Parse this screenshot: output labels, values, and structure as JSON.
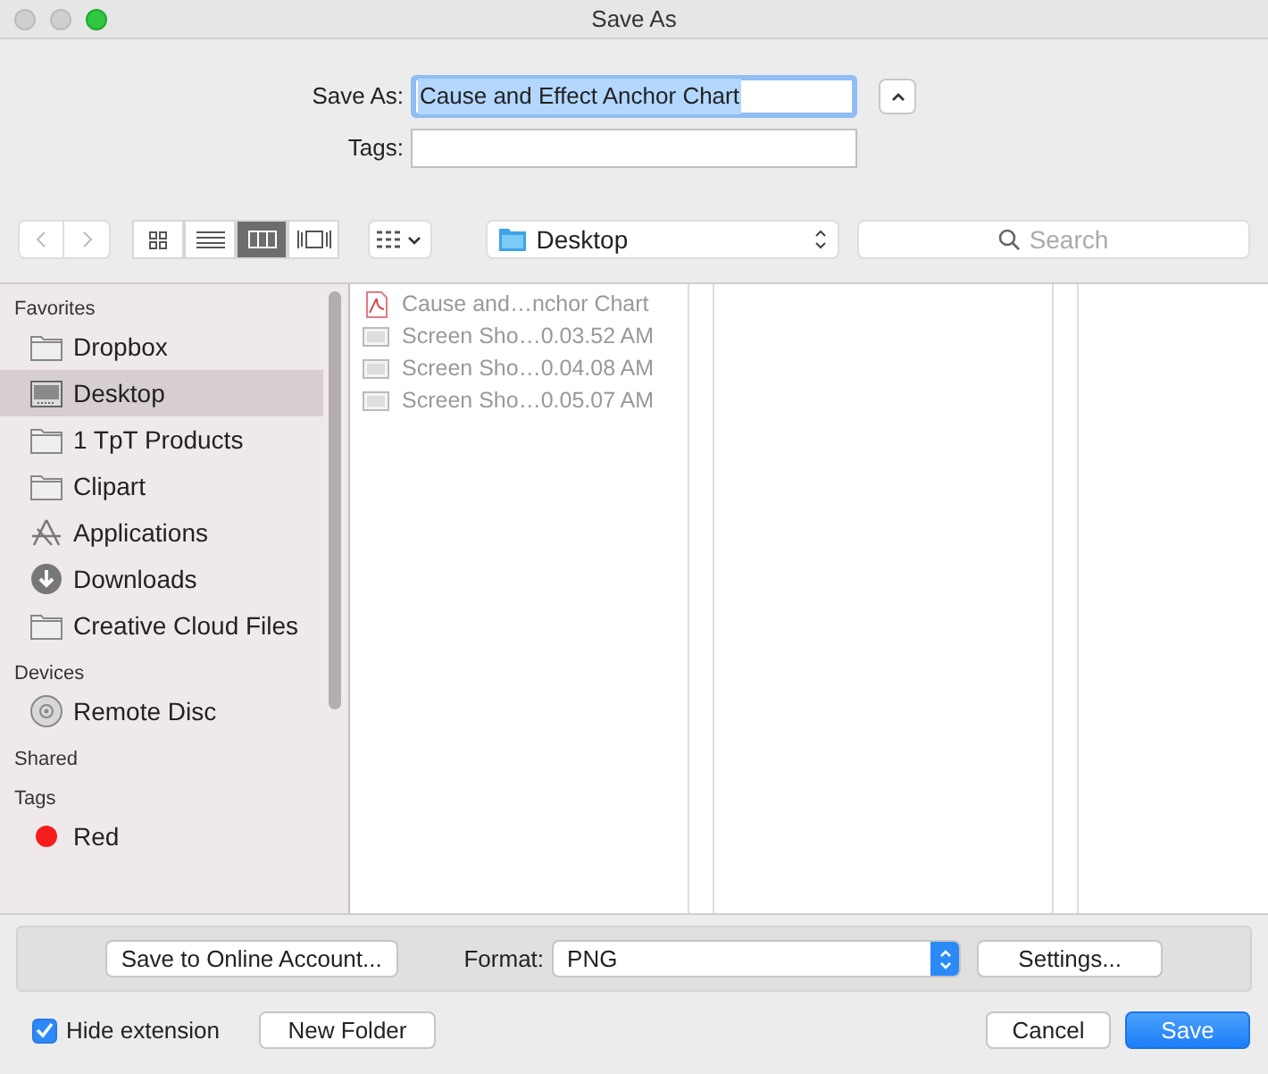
{
  "window": {
    "title": "Save As"
  },
  "save_as": {
    "label": "Save As:",
    "value": "Cause and Effect Anchor Chart",
    "selected_text": true
  },
  "tags": {
    "label": "Tags:"
  },
  "toolbar": {
    "views": [
      {
        "kind": "icons",
        "selected": false
      },
      {
        "kind": "list",
        "selected": false
      },
      {
        "kind": "columns",
        "selected": true
      },
      {
        "kind": "coverflow",
        "selected": false
      }
    ],
    "location": "Desktop",
    "search": {
      "placeholder": "Search"
    }
  },
  "sidebar": {
    "sections": [
      {
        "title": "Favorites",
        "items": [
          {
            "label": "Dropbox",
            "kind": "folder",
            "selected": false
          },
          {
            "label": "Desktop",
            "kind": "desktop",
            "selected": true
          },
          {
            "label": "1 TpT Products",
            "kind": "folder",
            "selected": false
          },
          {
            "label": "Clipart",
            "kind": "folder",
            "selected": false
          },
          {
            "label": "Applications",
            "kind": "apps",
            "selected": false
          },
          {
            "label": "Downloads",
            "kind": "download",
            "selected": false
          },
          {
            "label": "Creative Cloud Files",
            "kind": "folder",
            "selected": false
          }
        ]
      },
      {
        "title": "Devices",
        "items": [
          {
            "label": "Remote Disc",
            "kind": "disc",
            "selected": false
          }
        ]
      },
      {
        "title": "Shared"
      },
      {
        "title": "Tags",
        "items": [
          {
            "label": "Red",
            "kind": "tag",
            "color": "#f41e1e",
            "selected": false
          }
        ]
      }
    ]
  },
  "files": [
    {
      "name": "Cause and…nchor Chart",
      "kind": "pdf"
    },
    {
      "name": "Screen Sho…0.03.52 AM",
      "kind": "image"
    },
    {
      "name": "Screen Sho…0.04.08 AM",
      "kind": "image"
    },
    {
      "name": "Screen Sho…0.05.07 AM",
      "kind": "image"
    }
  ],
  "options": {
    "online_button": "Save to Online Account...",
    "format_label": "Format:",
    "format": "PNG",
    "settings_button": "Settings..."
  },
  "hide_extension": {
    "label": "Hide extension",
    "checked": true
  },
  "buttons": {
    "new_folder": "New Folder",
    "cancel": "Cancel",
    "save": "Save"
  }
}
